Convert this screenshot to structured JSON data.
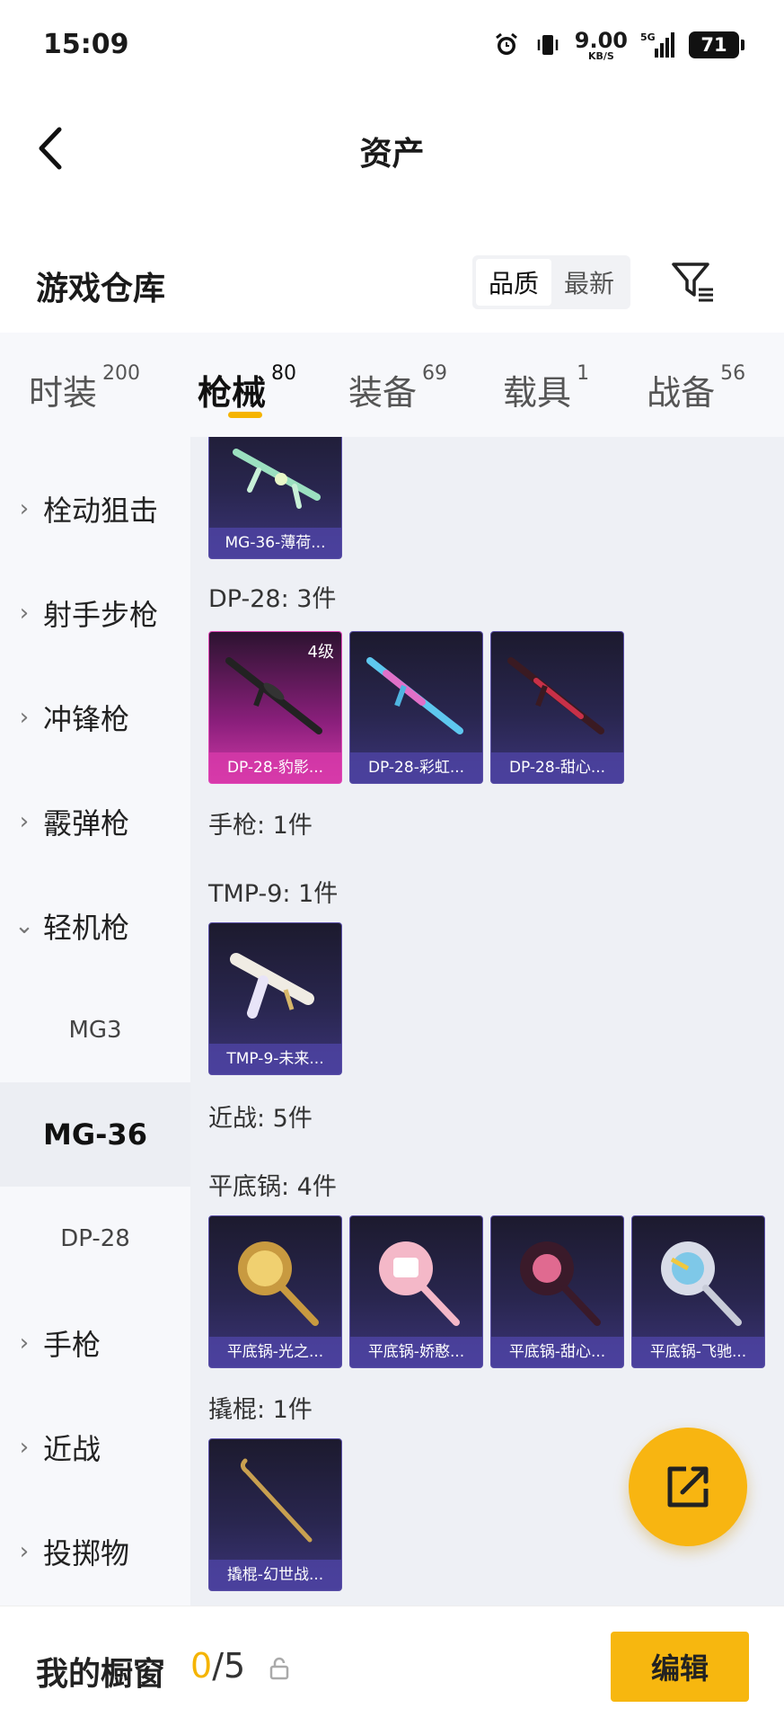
{
  "status_bar": {
    "time": "15:09",
    "speed_value": "9.00",
    "speed_unit": "KB/S",
    "network": "5G",
    "battery": "71"
  },
  "header": {
    "title": "资产"
  },
  "warehouse": {
    "title": "游戏仓库",
    "sort_options": [
      {
        "label": "品质",
        "active": true
      },
      {
        "label": "最新",
        "active": false
      }
    ]
  },
  "tabs": [
    {
      "label": "时装",
      "count": "200",
      "active": false
    },
    {
      "label": "枪械",
      "count": "80",
      "active": true
    },
    {
      "label": "装备",
      "count": "69",
      "active": false
    },
    {
      "label": "载具",
      "count": "1",
      "active": false
    },
    {
      "label": "战备",
      "count": "56",
      "active": false
    }
  ],
  "sidebar": {
    "items": [
      {
        "label": "栓动狙击",
        "expanded": false
      },
      {
        "label": "射手步枪",
        "expanded": false
      },
      {
        "label": "冲锋枪",
        "expanded": false
      },
      {
        "label": "霰弹枪",
        "expanded": false
      },
      {
        "label": "轻机枪",
        "expanded": true
      },
      {
        "label": "MG3",
        "sub": true
      },
      {
        "label": "MG-36",
        "sub": true,
        "selected": true
      },
      {
        "label": "DP-28",
        "sub": true
      },
      {
        "label": "手枪",
        "expanded": false
      },
      {
        "label": "近战",
        "expanded": false
      },
      {
        "label": "投掷物",
        "expanded": false
      }
    ]
  },
  "content": {
    "sections": {
      "dp28": "DP-28: 3件",
      "pistol": "手枪: 1件",
      "tmp9": "TMP-9: 1件",
      "melee": "近战: 5件",
      "pan": "平底锅: 4件",
      "crowbar": "撬棍: 1件"
    },
    "cards": {
      "mg36": {
        "label": "MG-36-薄荷...",
        "icon": "mg36-rifle-icon"
      },
      "dp28_1": {
        "label": "DP-28-豹影...",
        "level": "4级",
        "icon": "dp28-rifle-icon"
      },
      "dp28_2": {
        "label": "DP-28-彩虹...",
        "icon": "dp28-rifle-icon"
      },
      "dp28_3": {
        "label": "DP-28-甜心...",
        "icon": "dp28-rifle-icon"
      },
      "tmp9": {
        "label": "TMP-9-未来...",
        "icon": "tmp9-pistol-icon"
      },
      "pan_1": {
        "label": "平底锅-光之...",
        "icon": "pan-icon"
      },
      "pan_2": {
        "label": "平底锅-娇憨...",
        "icon": "pan-icon"
      },
      "pan_3": {
        "label": "平底锅-甜心...",
        "icon": "pan-icon"
      },
      "pan_4": {
        "label": "平底锅-飞驰...",
        "icon": "pan-icon"
      },
      "crowbar": {
        "label": "撬棍-幻世战...",
        "icon": "crowbar-icon"
      }
    }
  },
  "bottom_bar": {
    "label": "我的橱窗",
    "count_current": "0",
    "count_total": "/5",
    "edit_label": "编辑"
  },
  "colors": {
    "accent": "#f7b70f",
    "card_purple": "#3b3478",
    "card_pink": "#d23aa8"
  }
}
